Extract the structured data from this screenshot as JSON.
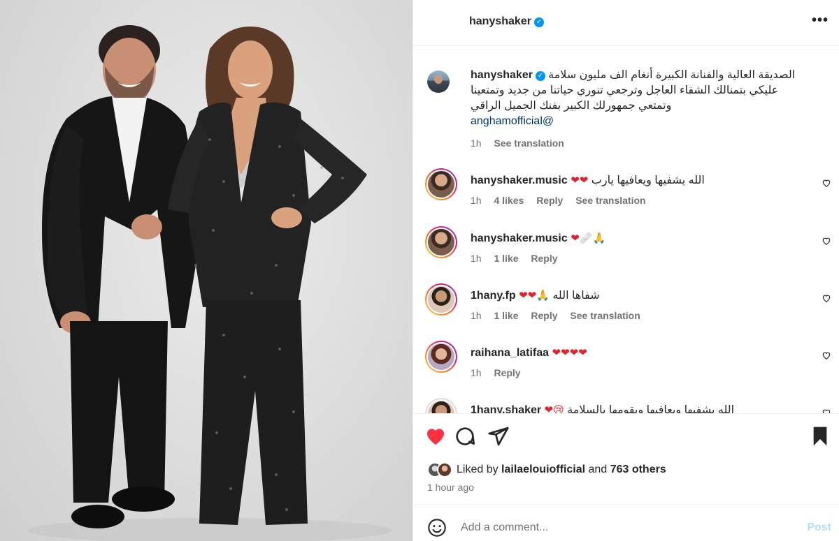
{
  "post": {
    "username": "hanyshaker",
    "more_icon": "more-horizontal-icon",
    "caption": {
      "username": "hanyshaker",
      "line1": "الصديقة العالية والفنانة الكبيرة أنغام الف مليون سلامة",
      "line2": "عليكي بتمنالك الشفاء العاجل وترجعي تنوري حياتنا من جديد وتمتعينا",
      "line3": "وتمتعي جمهورلك الكبير بفنك الجميل الراقي",
      "mention": "anghamofficial@",
      "time": "1h",
      "translate": "See translation"
    }
  },
  "comments": [
    {
      "username": "hanyshaker.music",
      "text": "الله يشفيها ويعافيها يارب",
      "emoji": "❤❤",
      "time": "1h",
      "likes": "4 likes",
      "reply": "Reply",
      "translate": "See translation"
    },
    {
      "username": "hanyshaker.music",
      "text": "",
      "emoji": "❤🩹🙏",
      "time": "1h",
      "likes": "1 like",
      "reply": "Reply",
      "translate": ""
    },
    {
      "username": "1hany.fp",
      "text": "شفاها الله",
      "emoji": "❤❤🙏",
      "time": "1h",
      "likes": "1 like",
      "reply": "Reply",
      "translate": "See translation"
    },
    {
      "username": "raihana_latifaa",
      "text": "",
      "emoji": "❤❤❤❤",
      "time": "1h",
      "likes": "",
      "reply": "Reply",
      "translate": ""
    },
    {
      "username": "1hany.shaker",
      "text": "الله يشفيها ويعافيها ويقومها بالسلامة",
      "emoji": "❤😢",
      "time": "",
      "likes": "",
      "reply": "",
      "translate": ""
    }
  ],
  "actions": {
    "like_icon": "heart-filled-icon",
    "comment_icon": "comment-icon",
    "share_icon": "share-icon",
    "save_icon": "bookmark-filled-icon",
    "like_color": "#ff3040"
  },
  "liked_by": {
    "prefix": "Liked by",
    "user": "laila­elouiofficial",
    "and": "and",
    "others": "763 others"
  },
  "time_ago": "1 hour ago",
  "add_comment": {
    "placeholder": "Add a comment...",
    "post_label": "Post",
    "post_color": "#b2dffc"
  }
}
